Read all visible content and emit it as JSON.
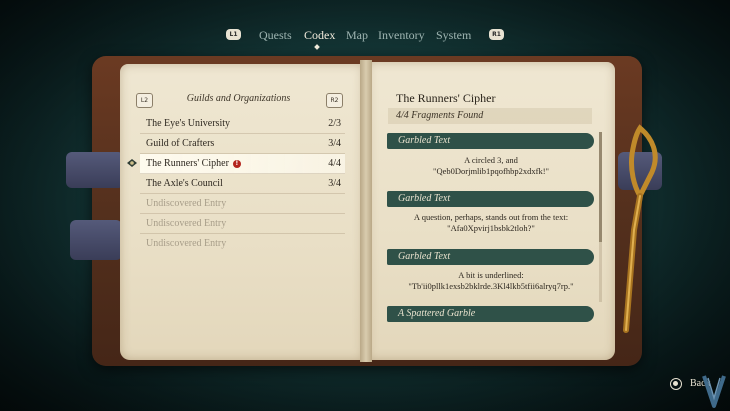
{
  "nav": {
    "left_shoulder": "L1",
    "right_shoulder": "R1",
    "tabs": [
      {
        "label": "Quests",
        "active": false
      },
      {
        "label": "Codex",
        "active": true
      },
      {
        "label": "Map",
        "active": false
      },
      {
        "label": "Inventory",
        "active": false
      },
      {
        "label": "System",
        "active": false
      }
    ]
  },
  "left_page": {
    "prev_tag": "L2",
    "next_tag": "R2",
    "category_title": "Guilds and Organizations",
    "entries": [
      {
        "name": "The Eye's University",
        "count": "2/3"
      },
      {
        "name": "Guild of Crafters",
        "count": "3/4"
      },
      {
        "name": "The Runners' Cipher",
        "count": "4/4",
        "badge": "!",
        "selected": true
      },
      {
        "name": "The Axle's Council",
        "count": "3/4"
      },
      {
        "name": "Undiscovered Entry",
        "count": ""
      },
      {
        "name": "Undiscovered Entry",
        "count": ""
      },
      {
        "name": "Undiscovered Entry",
        "count": ""
      }
    ]
  },
  "right_page": {
    "title": "The Runners' Cipher",
    "fragments_found": "4/4 Fragments Found",
    "sections": [
      {
        "heading": "Garbled Text",
        "line1": "A circled 3, and",
        "line2": "\"Qeb0Dorjmlib1pqofhbp2xdxfk!\""
      },
      {
        "heading": "Garbled Text",
        "line1": "A question, perhaps, stands out from the text:",
        "line2": "\"Afa0Xpvirj1bsbk2tloh?\""
      },
      {
        "heading": "Garbled Text",
        "line1": "A bit is underlined:",
        "line2": "\"Tb'ii0pllk1exsb2bklrde.3Kl4lkb5tfii6alryq7rp.\""
      },
      {
        "heading": "A Spattered Garble",
        "line1": "",
        "line2": ""
      }
    ]
  },
  "footer": {
    "back_label": "Back"
  },
  "colors": {
    "banner": "#2f5148",
    "page": "#ebe2ca",
    "cover": "#5a321e",
    "alert": "#b3241d"
  }
}
